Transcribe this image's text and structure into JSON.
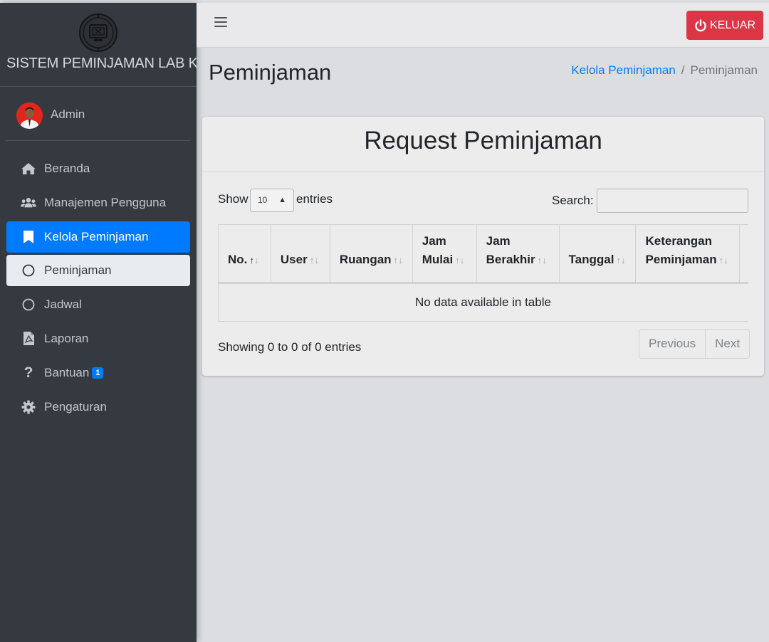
{
  "brand": {
    "title": "SISTEM PEMINJAMAN LAB KOMPUTER"
  },
  "user": {
    "name": "Admin"
  },
  "nav": [
    {
      "label": "Beranda",
      "icon": "home-icon"
    },
    {
      "label": "Manajemen Pengguna",
      "icon": "users-icon"
    },
    {
      "label": "Kelola Peminjaman",
      "icon": "bookmark-icon",
      "active": true
    },
    {
      "label": "Peminjaman",
      "icon": "circle-icon",
      "sub_active": true
    },
    {
      "label": "Jadwal",
      "icon": "circle-icon"
    },
    {
      "label": "Laporan",
      "icon": "pdf-file-icon"
    },
    {
      "label": "Bantuan",
      "icon": "question-icon",
      "badge": "1"
    },
    {
      "label": "Pengaturan",
      "icon": "gear-icon"
    }
  ],
  "topbar": {
    "logout_label": "KELUAR"
  },
  "page": {
    "title": "Peminjaman",
    "breadcrumb": [
      "Kelola Peminjaman",
      "Peminjaman"
    ]
  },
  "card": {
    "title": "Request Peminjaman",
    "show_label": "Show",
    "entries_value": "10",
    "entries_label": "entries",
    "search_label": "Search:",
    "columns": [
      {
        "line1": "",
        "line2": "No."
      },
      {
        "line1": "",
        "line2": "User"
      },
      {
        "line1": "",
        "line2": "Ruangan"
      },
      {
        "line1": "Jam",
        "line2": "Mulai"
      },
      {
        "line1": "Jam",
        "line2": "Berakhir"
      },
      {
        "line1": "",
        "line2": "Tanggal"
      },
      {
        "line1": "Keterangan",
        "line2": "Peminjaman"
      },
      {
        "line1": "",
        "line2": ""
      }
    ],
    "empty_text": "No data available in table",
    "info": "Showing 0 to 0 of 0 entries",
    "prev_label": "Previous",
    "next_label": "Next"
  },
  "colors": {
    "primary": "#007bff",
    "danger": "#dc3545",
    "sidebar": "#343a40"
  }
}
